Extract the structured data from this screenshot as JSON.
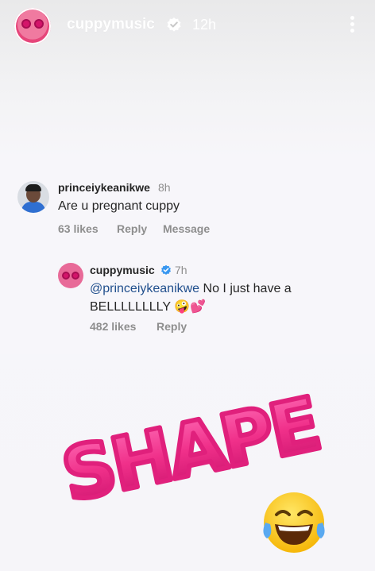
{
  "story": {
    "username": "cuppymusic",
    "time": "12h",
    "verified_icon": "verified-badge-icon",
    "more_icon": "more-vertical-icon"
  },
  "comment": {
    "user": "princeiykeanikwe",
    "time": "8h",
    "text": "Are u pregnant cuppy",
    "likes": "63 likes",
    "reply_label": "Reply",
    "message_label": "Message"
  },
  "reply": {
    "user": "cuppymusic",
    "time": "7h",
    "mention": "@princeiykeanikwe",
    "text_line1": " No I just have a",
    "text_line2": "BELLLLLLLLY",
    "emojis": "🤪💕",
    "likes": "482 likes",
    "reply_label": "Reply"
  },
  "sticker": {
    "word": "SHAPE"
  },
  "colors": {
    "accent_blue": "#3897f0",
    "sticker_pink": "#f0308a",
    "meta_gray": "#8e8e8e"
  }
}
